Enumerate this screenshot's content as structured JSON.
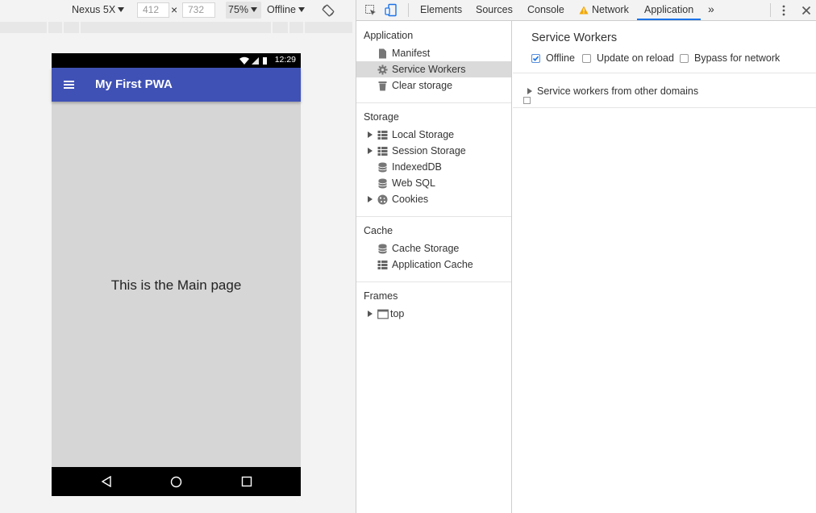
{
  "emulation": {
    "device": "Nexus 5X",
    "width": "412",
    "height": "732",
    "times_symbol": "×",
    "zoom": "75%",
    "throttle": "Offline"
  },
  "phone": {
    "clock": "12:29",
    "app_title": "My First PWA",
    "main_text": "This is the Main page",
    "appbar_color": "#3f51b5"
  },
  "devtools": {
    "tabs": [
      "Elements",
      "Sources",
      "Console",
      "Network",
      "Application"
    ],
    "active_tab": "Application",
    "more_tabs": "»",
    "sidebar": {
      "application": {
        "title": "Application",
        "items": [
          "Manifest",
          "Service Workers",
          "Clear storage"
        ]
      },
      "storage": {
        "title": "Storage",
        "items": [
          "Local Storage",
          "Session Storage",
          "IndexedDB",
          "Web SQL",
          "Cookies"
        ]
      },
      "cache": {
        "title": "Cache",
        "items": [
          "Cache Storage",
          "Application Cache"
        ]
      },
      "frames": {
        "title": "Frames",
        "items": [
          "top"
        ]
      }
    },
    "panel": {
      "title": "Service Workers",
      "options": [
        {
          "label": "Offline",
          "checked": true
        },
        {
          "label": "Update on reload",
          "checked": false
        },
        {
          "label": "Bypass for network",
          "checked": false
        }
      ],
      "other_domains": "Service workers from other domains"
    }
  }
}
